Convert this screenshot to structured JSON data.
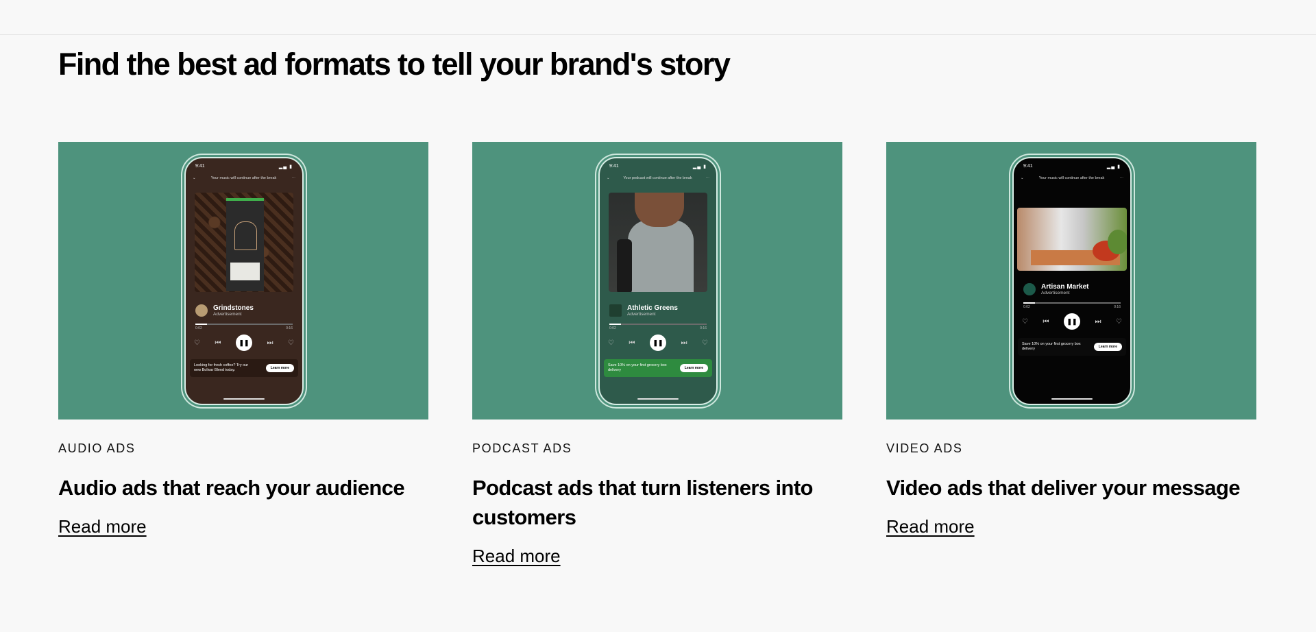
{
  "page": {
    "title": "Find the best ad formats to tell your brand's story"
  },
  "cards": [
    {
      "eyebrow": "AUDIO ADS",
      "title": "Audio ads that reach your audience",
      "link": "Read more",
      "phone": {
        "time": "9:41",
        "notice": "Your music will continue after the break",
        "name": "Grindstones",
        "sub": "Advertisement",
        "elapsed": "0:02",
        "remaining": "0:16",
        "progress_fraction": 0.12,
        "cta_text": "Looking for fresh coffee? Try our new Bolivar Blend today.",
        "cta_button": "Learn more"
      }
    },
    {
      "eyebrow": "PODCAST ADS",
      "title": "Podcast ads that turn listeners into customers",
      "link": "Read more",
      "phone": {
        "time": "9:41",
        "notice": "Your podcast will continue after the break",
        "name": "Athletic Greens",
        "sub": "Advertisement",
        "elapsed": "0:02",
        "remaining": "0:16",
        "progress_fraction": 0.12,
        "cta_text": "Save 10% on your first grocery box delivery",
        "cta_button": "Learn more"
      }
    },
    {
      "eyebrow": "VIDEO ADS",
      "title": "Video ads that deliver your message",
      "link": "Read more",
      "phone": {
        "time": "9:41",
        "notice": "Your music will continue after the break",
        "name": "Artisan Market",
        "sub": "Advertisement",
        "elapsed": "0:02",
        "remaining": "0:16",
        "progress_fraction": 0.12,
        "cta_text": "Save 10% on your first grocery box delivery",
        "cta_button": "Learn more"
      }
    }
  ],
  "colors": {
    "card_bg": "#4e937d",
    "page_bg": "#f8f8f8"
  }
}
